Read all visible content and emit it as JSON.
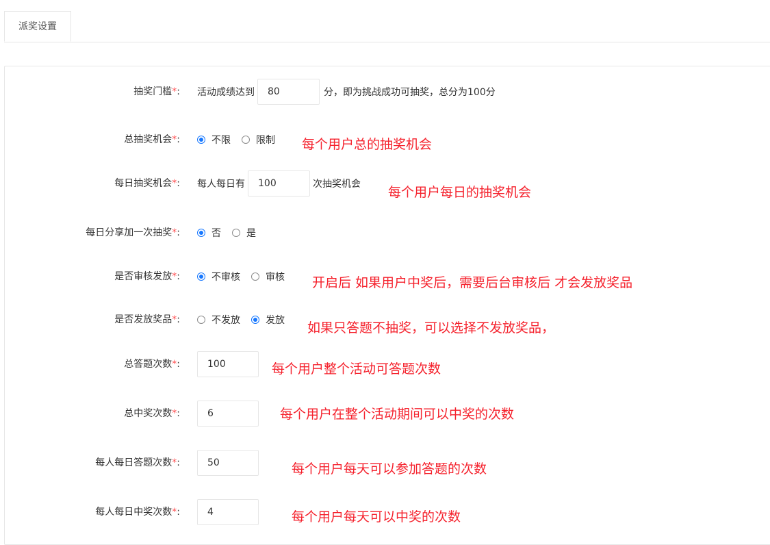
{
  "tabs": [
    {
      "label": "派奖设置"
    }
  ],
  "form": {
    "threshold": {
      "label": "抽奖门槛",
      "prefix": "活动成绩达到",
      "value": "80",
      "suffix": "分，即为挑战成功可抽奖，总分为100分"
    },
    "total_chances": {
      "label": "总抽奖机会",
      "options": [
        "不限",
        "限制"
      ],
      "selected": 0,
      "note": "每个用户总的抽奖机会"
    },
    "daily_chances": {
      "label": "每日抽奖机会",
      "prefix": "每人每日有",
      "value": "100",
      "suffix": "次抽奖机会",
      "note": "每个用户每日的抽奖机会"
    },
    "daily_share_bonus": {
      "label": "每日分享加一次抽奖",
      "options": [
        "否",
        "是"
      ],
      "selected": 0
    },
    "review_release": {
      "label": "是否审核发放",
      "options": [
        "不审核",
        "审核"
      ],
      "selected": 0,
      "note": "开启后 如果用户中奖后，需要后台审核后 才会发放奖品"
    },
    "issue_prizes": {
      "label": "是否发放奖品",
      "options": [
        "不发放",
        "发放"
      ],
      "selected": 1,
      "note": "如果只答题不抽奖，可以选择不发放奖品，"
    },
    "total_answers": {
      "label": "总答题次数",
      "value": "100",
      "note": "每个用户整个活动可答题次数"
    },
    "total_wins": {
      "label": "总中奖次数",
      "value": "6",
      "note": "每个用户在整个活动期间可以中奖的次数"
    },
    "daily_answers": {
      "label": "每人每日答题次数",
      "value": "50",
      "note": "每个用户每天可以参加答题的次数"
    },
    "daily_wins": {
      "label": "每人每日中奖次数",
      "value": "4",
      "note": "每个用户每天可以中奖的次数"
    }
  },
  "required_mark": "*",
  "label_colon": ":",
  "colors": {
    "accent": "#1677ff",
    "required": "#ff4d4f",
    "note": "#f5222d",
    "border": "#e6e6e6"
  }
}
